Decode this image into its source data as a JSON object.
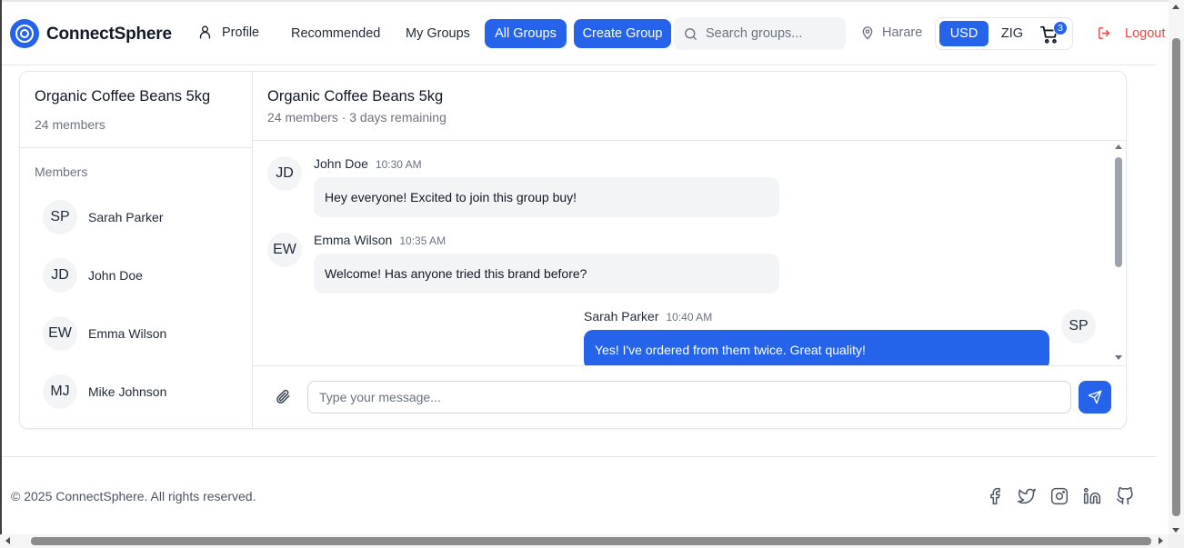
{
  "header": {
    "brand": "ConnectSphere",
    "nav": {
      "profile": "Profile",
      "recommended": "Recommended",
      "my_groups": "My Groups",
      "all_groups": "All Groups",
      "create_group": "Create Group"
    },
    "search": {
      "placeholder": "Search groups..."
    },
    "location": "Harare",
    "currency": {
      "usd": "USD",
      "zig": "ZIG",
      "selected": "USD"
    },
    "cart_count": "3",
    "logout": "Logout",
    "accent_color": "#2563eb",
    "logout_color": "#ef4444"
  },
  "sidebar": {
    "title": "Organic Coffee Beans 5kg",
    "subtitle": "24 members",
    "members_label": "Members",
    "members": [
      {
        "initials": "SP",
        "name": "Sarah Parker"
      },
      {
        "initials": "JD",
        "name": "John Doe"
      },
      {
        "initials": "EW",
        "name": "Emma Wilson"
      },
      {
        "initials": "MJ",
        "name": "Mike Johnson"
      }
    ]
  },
  "chat": {
    "title": "Organic Coffee Beans 5kg",
    "subtitle": "24 members · 3 days remaining",
    "messages": [
      {
        "initials": "JD",
        "author": "John Doe",
        "time": "10:30 AM",
        "text": "Hey everyone! Excited to join this group buy!"
      },
      {
        "initials": "EW",
        "author": "Emma Wilson",
        "time": "10:35 AM",
        "text": "Welcome! Has anyone tried this brand before?"
      },
      {
        "initials": "SP",
        "author": "Sarah Parker",
        "time": "10:40 AM",
        "text": "Yes! I've ordered from them twice. Great quality!"
      }
    ],
    "input_placeholder": "Type your message..."
  },
  "footer": {
    "copyright": "© 2025 ConnectSphere. All rights reserved.",
    "social": [
      "facebook-icon",
      "twitter-icon",
      "instagram-icon",
      "linkedin-icon",
      "github-icon"
    ]
  }
}
